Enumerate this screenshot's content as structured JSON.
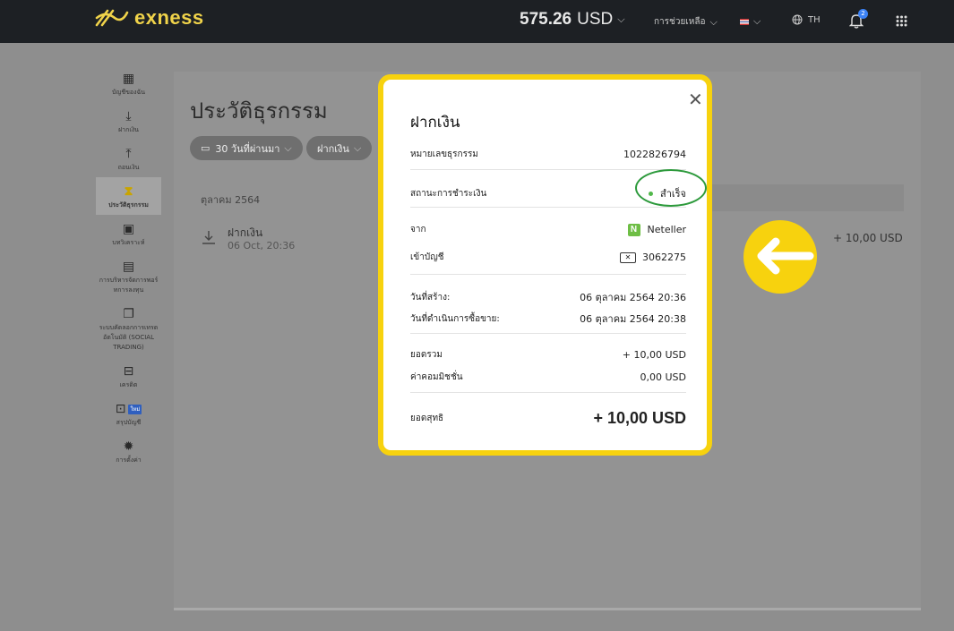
{
  "header": {
    "logo_text": "exness",
    "balance_amount": "575.26",
    "balance_currency": "USD",
    "help_label": "การช่วยเหลือ",
    "flag_label": "🇹🇭",
    "language": "TH",
    "notification_count": "2"
  },
  "sidebar": {
    "items": [
      {
        "label": "บัญชีของฉัน",
        "icon": "accounts-icon"
      },
      {
        "label": "ฝากเงิน",
        "icon": "deposit-icon"
      },
      {
        "label": "ถอนเงิน",
        "icon": "withdraw-icon"
      },
      {
        "label": "ประวัติธุรกรรม",
        "icon": "history-icon"
      },
      {
        "label": "บทวิเคราะห์",
        "icon": "analysis-icon"
      },
      {
        "label": "การบริหารจัดการพอร์ทการลงทุน",
        "icon": "portfolio-icon"
      },
      {
        "label": "ระบบคัดลอกการเทรดอัตโนมัติ (SOCIAL TRADING)",
        "icon": "social-trading-icon"
      },
      {
        "label": "เครดิต",
        "icon": "credit-icon"
      },
      {
        "label": "สรุปบัญชี",
        "icon": "summary-icon",
        "badge": "ใหม่"
      },
      {
        "label": "การตั้งค่า",
        "icon": "settings-icon"
      }
    ],
    "active_index": 3
  },
  "main": {
    "title": "ประวัติธุรกรรม",
    "filter_period": "30 วันที่ผ่านมา",
    "filter_type": "ฝากเงิน",
    "month_label": "ตุลาคม 2564",
    "transaction": {
      "name": "ฝากเงิน",
      "date": "06 Oct, 20:36",
      "amount": "+ 10,00 USD"
    }
  },
  "modal": {
    "title": "ฝากเงิน",
    "rows": {
      "tx_number_label": "หมายเลขธุรกรรม",
      "tx_number": "1022826794",
      "status_label": "สถานะการชำระเงิน",
      "status_value": "สำเร็จ",
      "from_label": "จาก",
      "from_value": "Neteller",
      "to_account_label": "เข้าบัญชี",
      "to_account_value": "3062275",
      "created_label": "วันที่สร้าง:",
      "created_value": "06 ตุลาคม 2564 20:36",
      "executed_label": "วันที่ดำเนินการซื้อขาย:",
      "executed_value": "06 ตุลาคม 2564 20:38",
      "total_label": "ยอดรวม",
      "total_value": "+ 10,00 USD",
      "commission_label": "ค่าคอมมิชชั่น",
      "commission_value": "0,00 USD",
      "net_label": "ยอดสุทธิ",
      "net_value": "+ 10,00 USD"
    }
  },
  "colors": {
    "accent_yellow": "#f7d20e",
    "success_green": "#51b84a",
    "topbar": "#1d2024"
  }
}
